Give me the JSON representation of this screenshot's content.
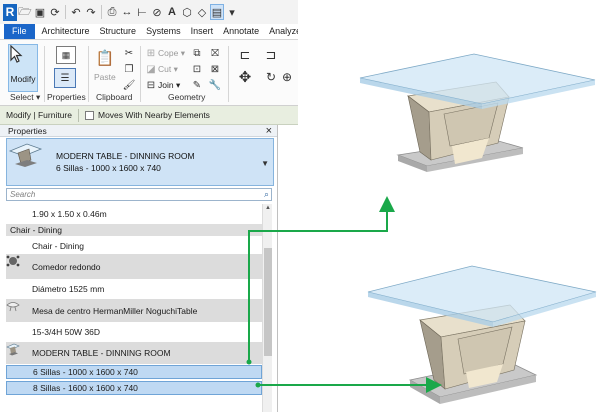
{
  "app": {
    "logo": "R"
  },
  "ribbon": {
    "tabs": [
      "File",
      "Architecture",
      "Structure",
      "Systems",
      "Insert",
      "Annotate",
      "Analyze"
    ],
    "modify_label": "Modify",
    "paste_label": "Paste",
    "cope_label": "Cope",
    "cut_label": "Cut",
    "join_label": "Join",
    "panels": {
      "select": "Select",
      "properties": "Properties",
      "clipboard": "Clipboard",
      "geometry": "Geometry"
    }
  },
  "modify_bar": {
    "context": "Modify | Furniture",
    "moves_with_nearby": "Moves With Nearby Elements"
  },
  "properties": {
    "title": "Properties",
    "close": "×",
    "type_selector": {
      "name": "MODERN TABLE - DINNING ROOM",
      "type": "6 Sillas - 1000 x 1600 x 740"
    },
    "search_placeholder": "Search",
    "rows": [
      {
        "kind": "item",
        "label": "1.90 x 1.50 x 0.46m"
      },
      {
        "kind": "family",
        "label": "Chair - Dining"
      },
      {
        "kind": "item",
        "label": "Chair - Dining"
      },
      {
        "kind": "icon",
        "label": "Comedor redondo",
        "icon": "round-table-icon"
      },
      {
        "kind": "item",
        "label": "Diámetro 1525 mm"
      },
      {
        "kind": "icon",
        "label": "Mesa de centro HermanMiller NoguchiTable",
        "icon": "noguchi-table-icon"
      },
      {
        "kind": "item",
        "label": "15-3/4H 50W 36D"
      },
      {
        "kind": "icon",
        "label": "MODERN TABLE - DINNING ROOM",
        "icon": "modern-table-icon"
      },
      {
        "kind": "selected",
        "label": "6 Sillas - 1000 x 1600 x 740"
      },
      {
        "kind": "selected",
        "label": "8 Sillas - 1600 x 1600 x 740"
      }
    ]
  },
  "colors": {
    "accent_blue": "#1b66c9",
    "arrow_green": "#1aa84a",
    "selection_blue": "#bfd9f3",
    "glass_blue": "#cfe6f5",
    "table_body": "#d9d0bd"
  }
}
